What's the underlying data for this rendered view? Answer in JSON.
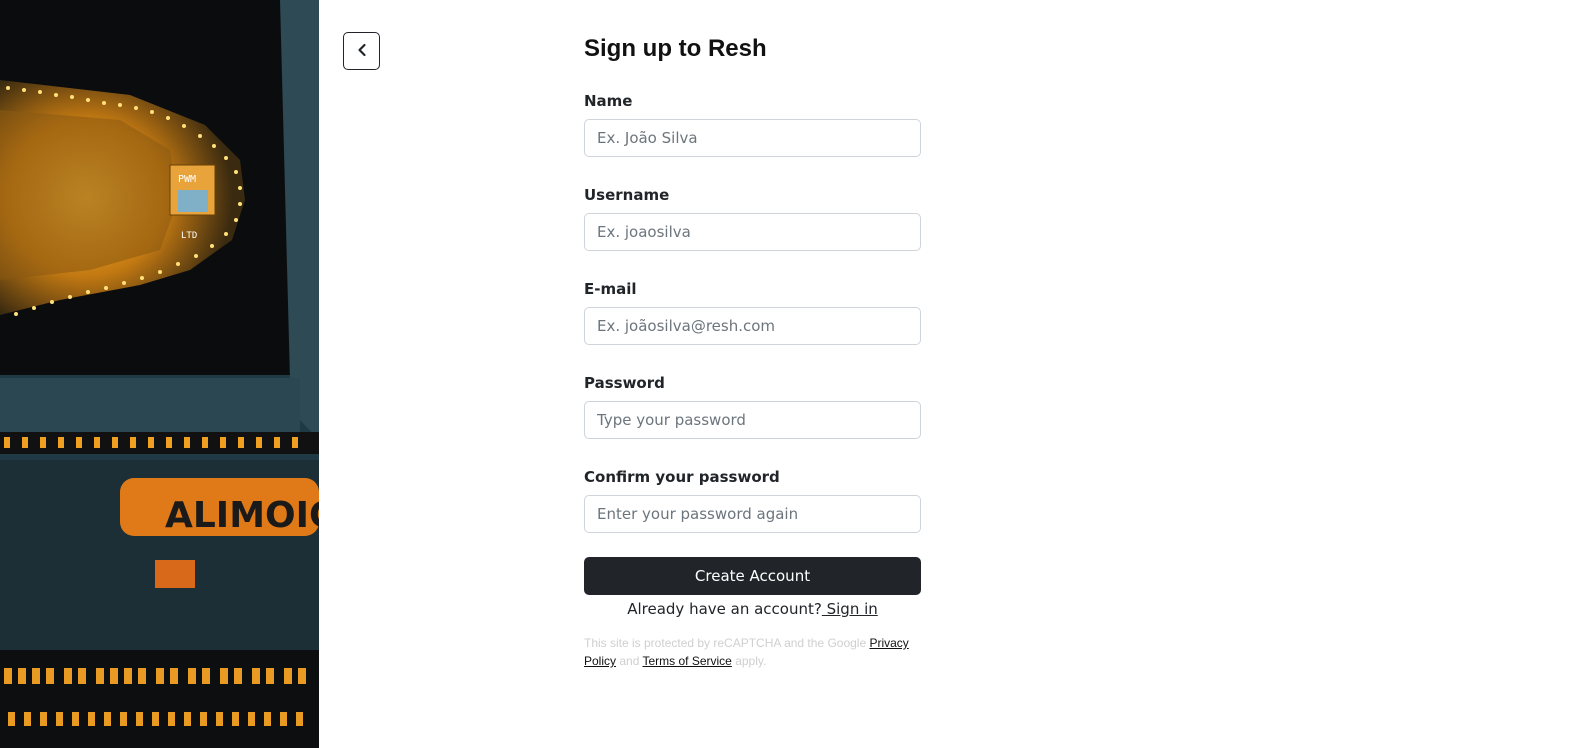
{
  "back": {
    "icon": "chevron-left-icon"
  },
  "form": {
    "title": "Sign up to Resh",
    "fields": [
      {
        "label": "Name",
        "placeholder": "Ex. João Silva",
        "value": ""
      },
      {
        "label": "Username",
        "placeholder": "Ex. joaosilva",
        "value": ""
      },
      {
        "label": "E-mail",
        "placeholder": "Ex. joãosilva@resh.com",
        "value": ""
      },
      {
        "label": "Password",
        "placeholder": "Type your password",
        "value": ""
      },
      {
        "label": "Confirm your password",
        "placeholder": "Enter your password again",
        "value": ""
      }
    ],
    "submit_label": "Create Account",
    "signin_prompt": "Already have an account?",
    "signin_link": " Sign in"
  },
  "legal": {
    "prefix": "This site is protected by reCAPTCHA and the Google ",
    "privacy_link": "Privacy Policy",
    "and": " and ",
    "terms_link": "Terms of Service",
    "suffix": " apply."
  },
  "hero": {
    "sign_text": "ALIMOIG",
    "chip_text_1": "PWM",
    "chip_text_2": "LTD"
  },
  "colors": {
    "button_bg": "#212529",
    "input_border": "#ced4da",
    "legal_text": "#cfcfcf",
    "hero_glow": "#f5a623"
  }
}
